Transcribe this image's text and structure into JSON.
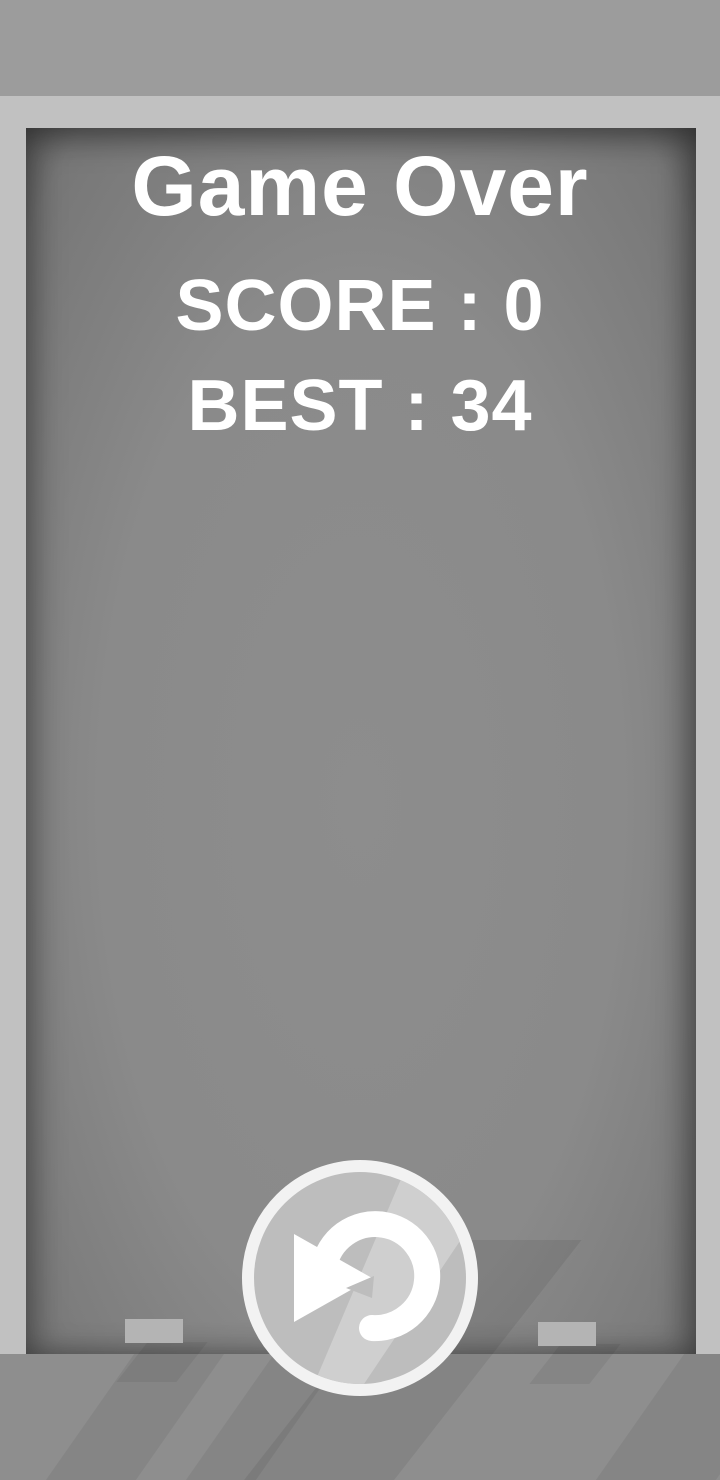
{
  "game": {
    "title": "Game Over",
    "score_text": "SCORE : 0",
    "best_text": "BEST : 34",
    "score": 0,
    "best": 34
  },
  "controls": {
    "replay_icon": "replay-icon"
  },
  "colors": {
    "text": "#ffffff",
    "background": "#8f8f8f",
    "frame": "#c1c1c1",
    "button_ring": "#f2f2f2",
    "button_fill": "#bdbdbd"
  }
}
